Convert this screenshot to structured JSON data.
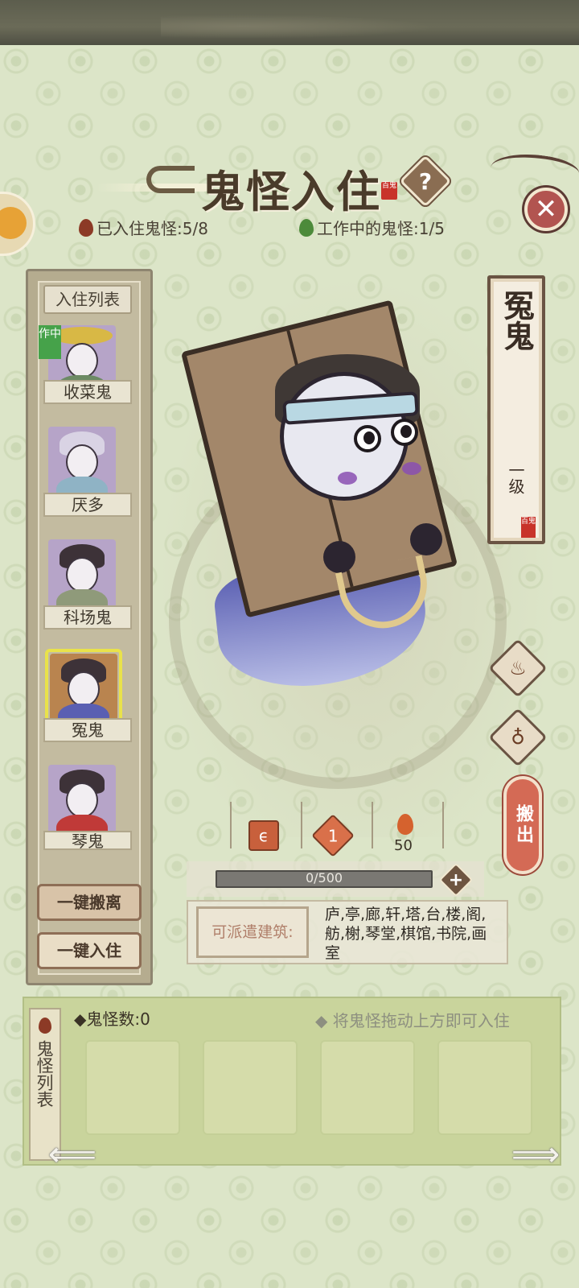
{
  "title": {
    "text": "鬼怪入住",
    "seal": "百鬼"
  },
  "stats": {
    "housed_label": "已入住鬼怪:5/8",
    "working_label": "工作中的鬼怪:1/5"
  },
  "residents": {
    "header": "入住列表",
    "working_badge": "作中",
    "items": [
      {
        "name": "收菜鬼",
        "working": true
      },
      {
        "name": "厌多",
        "working": false
      },
      {
        "name": "科场鬼",
        "working": false
      },
      {
        "name": "冤鬼",
        "working": false,
        "selected": true
      },
      {
        "name": "琴鬼",
        "working": false
      }
    ],
    "evict_all_label": "一键搬离",
    "house_all_label": "一键入住"
  },
  "selected_ghost": {
    "name": "冤鬼",
    "level": "一级",
    "seal": "百鬼",
    "move_out_label": "搬出",
    "badge_value": "1",
    "flame_value": "50",
    "progress": {
      "current": 0,
      "max": 500,
      "text": "0/500"
    },
    "buildings_label": "可派遣建筑:",
    "buildings": "庐,亭,廊,轩,塔,台,楼,阁,舫,榭,琴堂,棋馆,书院,画室"
  },
  "ghost_pool": {
    "side_label": "鬼怪列表",
    "count_label": "鬼怪数:0",
    "hint": "将鬼怪拖动上方即可入住",
    "slots": 4
  },
  "colors": {
    "background": "#dce5c8",
    "accent_red": "#c8332a",
    "working_green": "#46a24a",
    "move_out": "#d46a55"
  },
  "icons": {
    "help": "question-icon",
    "close": "close-icon",
    "left": "arrow-left-icon",
    "right": "arrow-right-icon"
  }
}
